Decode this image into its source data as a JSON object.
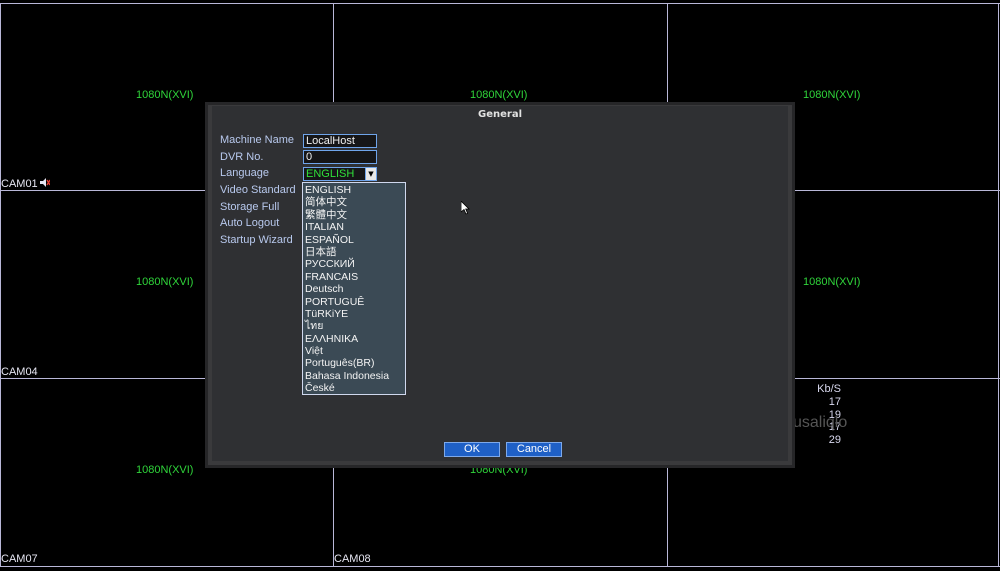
{
  "cameras": {
    "resolution": "1080N(XVI)",
    "labels": [
      "CAM01",
      "CAM04",
      "CAM07",
      "CAM08"
    ]
  },
  "bitrate": {
    "header": "Kb/S",
    "values": [
      "17",
      "19",
      "17",
      "29"
    ]
  },
  "watermark": "usaliqlo",
  "dialog": {
    "title": "General",
    "labels": {
      "machine_name": "Machine Name",
      "dvr_no": "DVR No.",
      "language": "Language",
      "video_standard": "Video Standard",
      "storage_full": "Storage Full",
      "auto_logout": "Auto Logout",
      "startup_wizard": "Startup Wizard"
    },
    "machine_name_value": "LocalHost",
    "dvr_no_value": "0",
    "language_value": "ENGLISH",
    "language_options": [
      "ENGLISH",
      "简体中文",
      "繁體中文",
      "ITALIAN",
      "ESPAÑOL",
      "日本語",
      "РУССКИЙ",
      "FRANCAIS",
      "Deutsch",
      "PORTUGUÊ",
      "TüRKiYE",
      "ไทย",
      "ΕΛΛΗΝΙΚΑ",
      "Việt",
      "Português(BR)",
      "Bahasa Indonesia",
      "České"
    ],
    "ok_label": "OK",
    "cancel_label": "Cancel"
  },
  "colors": {
    "grid": "#b9b7d8",
    "resolution_text": "#2fd43a",
    "button": "#1f60c6",
    "field_border": "#6fa4ea"
  }
}
